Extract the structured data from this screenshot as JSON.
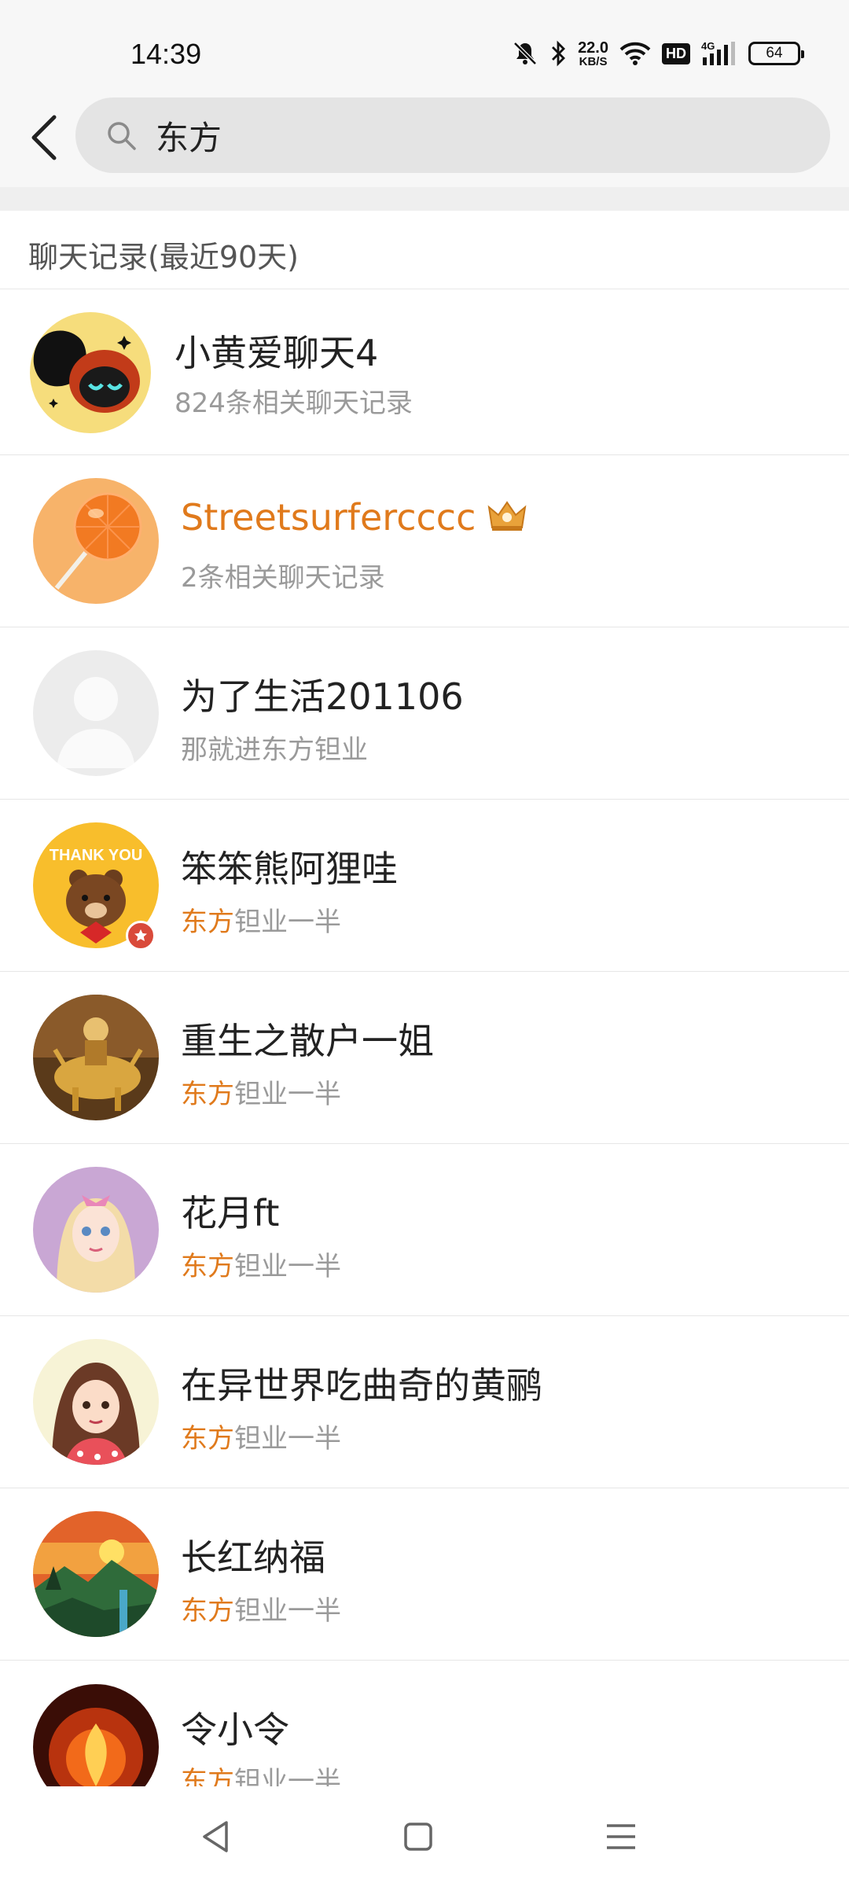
{
  "status_bar": {
    "time": "14:39",
    "net_speed_value": "22.0",
    "net_speed_unit": "KB/S",
    "hd_label": "HD",
    "network_type": "4G",
    "battery_level": "64",
    "icons": [
      "mute-bell-icon",
      "bluetooth-icon",
      "wifi-icon",
      "signal-icon",
      "battery-icon"
    ]
  },
  "search": {
    "query": "东方",
    "back_icon": "chevron-left-icon",
    "search_icon": "search-icon"
  },
  "section": {
    "title": "聊天记录(最近90天)"
  },
  "results": [
    {
      "name": "小黄爱聊天4",
      "sub": "824条相关聊天记录"
    },
    {
      "name": "Streetsurfercccc",
      "sub": "2条相关聊天记录",
      "vip": true
    },
    {
      "name": "为了生活201106",
      "sub": "那就进东方钽业"
    },
    {
      "name": "笨笨熊阿狸哇",
      "sub_highlight": "东方",
      "sub_rest": "钽业一半",
      "avatar_text": "THANK YOU"
    },
    {
      "name": "重生之散户一姐",
      "sub_highlight": "东方",
      "sub_rest": "钽业一半"
    },
    {
      "name": "花月ft",
      "sub_highlight": "东方",
      "sub_rest": "钽业一半"
    },
    {
      "name": "在异世界吃曲奇的黄鹂",
      "sub_highlight": "东方",
      "sub_rest": "钽业一半"
    },
    {
      "name": "长红纳福",
      "sub_highlight": "东方",
      "sub_rest": "钽业一半"
    },
    {
      "name": "令小令",
      "sub_highlight": "东方",
      "sub_rest": "钽业一半"
    }
  ],
  "colors": {
    "accent": "#e07a1c",
    "search_bg": "#e4e4e4",
    "header_bg": "#f7f7f7"
  },
  "nav_bar": {
    "icons": [
      "back-triangle-icon",
      "home-square-icon",
      "menu-lines-icon"
    ]
  }
}
